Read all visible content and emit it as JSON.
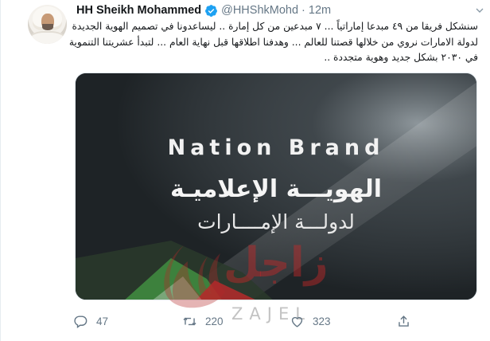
{
  "tweet": {
    "author_name": "HH Sheikh Mohammed",
    "handle": "@HHShkMohd",
    "separator": "·",
    "time": "12m",
    "text_lines": [
      "سنشكل فريقا من ٤٩ مبدعا إماراتياً ... ٧ مبدعين من كل إمارة .. ليساعدونا في تصميم الهوية الجديدة",
      "لدولة الامارات نروي من خلالها قصتنا للعالم ... وهدفنا اطلاقها قبل نهاية العام ... لتبدأ عشريتنا التنموية",
      "في ٢٠٣٠ بشكل جديد وهوية متجددة .."
    ]
  },
  "media": {
    "title_en": "Nation Brand",
    "title_ar": "الهويـــة الإعلاميـة",
    "subtitle_ar": "لدولـــة الإمــــارات"
  },
  "watermark": {
    "arabic": "زاجل",
    "latin": "ZAJEL"
  },
  "actions": {
    "reply_count": "47",
    "retweet_count": "220",
    "like_count": "323"
  },
  "icons": {
    "verified": "verified-badge-icon",
    "caret": "chevron-down-icon",
    "reply": "reply-icon",
    "retweet": "retweet-icon",
    "like": "heart-icon",
    "share": "share-icon"
  },
  "colors": {
    "verified_blue": "#1da1f2",
    "secondary_text": "#657786",
    "primary_text": "#14171a",
    "watermark_red": "#c82828"
  }
}
